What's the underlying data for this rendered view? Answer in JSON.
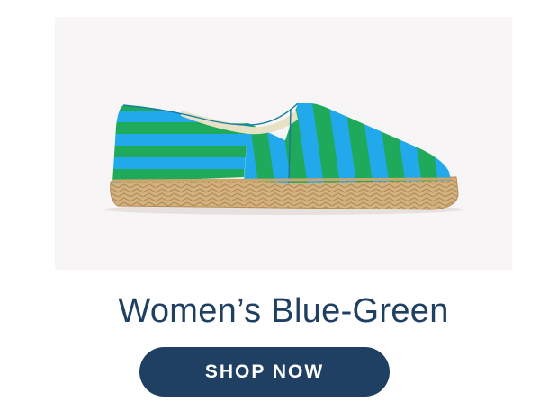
{
  "product": {
    "title": "Women’s Blue-Green",
    "image_icon": "striped-espadrille-shoe",
    "colors": {
      "stripe_blue": "#22a9ec",
      "stripe_green": "#1fa95b",
      "jute_sole": "#d4b27e",
      "background": "#f7f5f5"
    }
  },
  "cta": {
    "label": "SHOP NOW",
    "color": "#1f3f63"
  }
}
